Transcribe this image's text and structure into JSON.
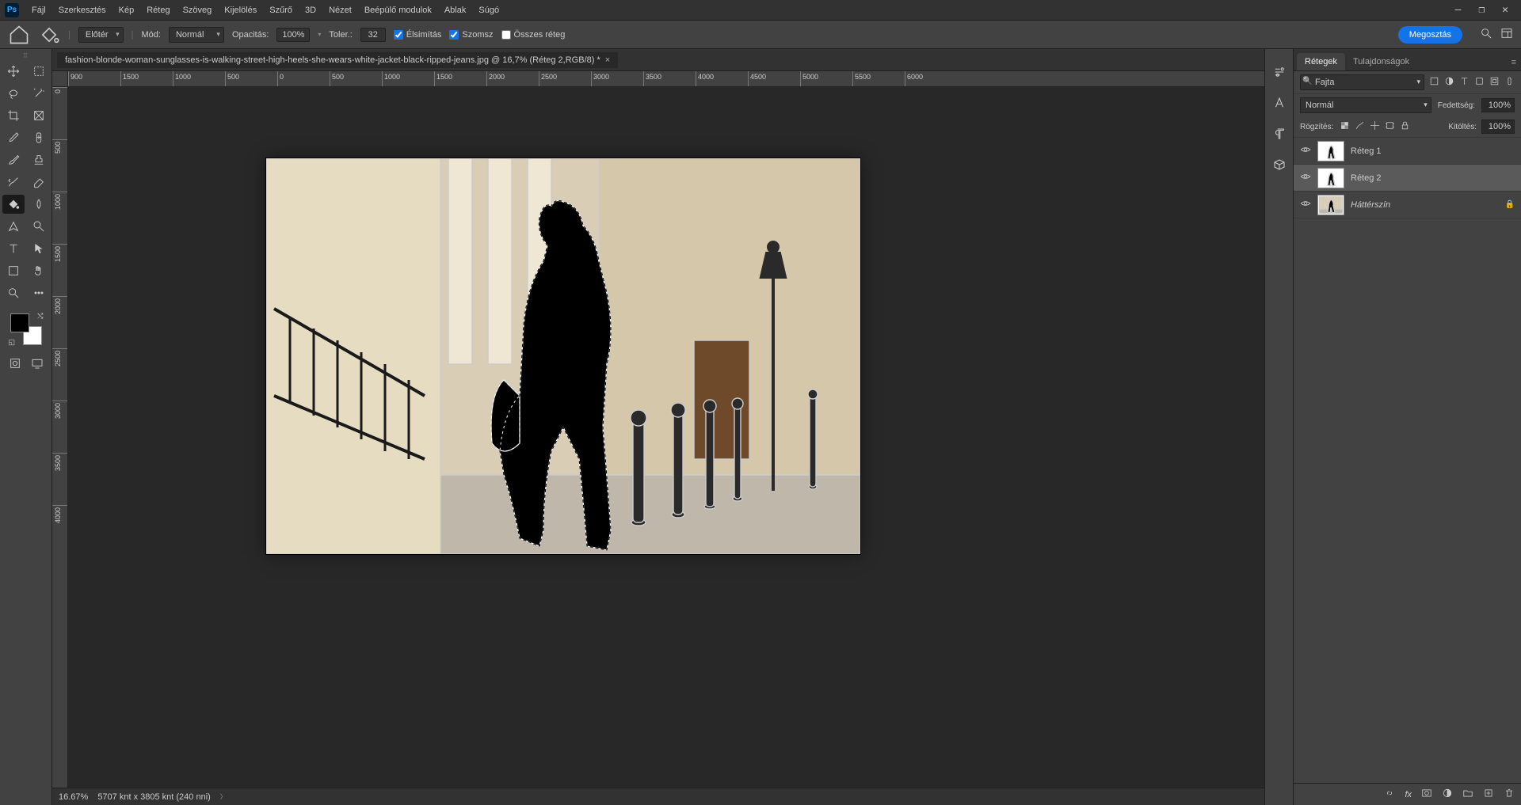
{
  "menu": {
    "items": [
      "Fájl",
      "Szerkesztés",
      "Kép",
      "Réteg",
      "Szöveg",
      "Kijelölés",
      "Szűrő",
      "3D",
      "Nézet",
      "Beépülő modulok",
      "Ablak",
      "Súgó"
    ]
  },
  "window_controls": {
    "min": "—",
    "max": "❐",
    "close": "✕"
  },
  "options": {
    "foreground_mode": "Előtér",
    "mode_label": "Mód:",
    "mode_value": "Normál",
    "opacity_label": "Opacitás:",
    "opacity_value": "100%",
    "tolerance_label": "Toler.:",
    "tolerance_value": "32",
    "antialias": "Élsimítás",
    "contiguous": "Szomsz",
    "all_layers": "Összes réteg",
    "share": "Megosztás"
  },
  "document": {
    "tab_title": "fashion-blonde-woman-sunglasses-is-walking-street-high-heels-she-wears-white-jacket-black-ripped-jeans.jpg @ 16,7% (Réteg 2,RGB/8) *",
    "zoom": "16.67%",
    "dims": "5707 knt x 3805 knt (240 nni)"
  },
  "ruler_h": [
    "-500",
    "-1000",
    "-1500",
    "0",
    "500",
    "1000",
    "1500",
    "2000",
    "2500",
    "3000",
    "3500",
    "4000",
    "4500",
    "5000",
    "5500",
    "6000"
  ],
  "ruler_h_offset_labels": [
    "-500",
    "-1000",
    "-1500",
    "0",
    "500",
    "1000",
    "1500",
    "2000",
    "2500",
    "3000",
    "3500",
    "4000",
    "4500",
    "5000",
    "5500",
    "6000"
  ],
  "ruler_v": [
    "0",
    "500",
    "1000",
    "1500",
    "2000",
    "2500",
    "3000",
    "3500",
    "4000"
  ],
  "panels": {
    "tabs": {
      "layers": "Rétegek",
      "properties": "Tulajdonságok"
    },
    "search_placeholder": "Fajta",
    "blend_mode": "Normál",
    "opacity_label": "Fedettség:",
    "opacity": "100%",
    "lock_label": "Rögzítés:",
    "fill_label": "Kitöltés:",
    "fill": "100%",
    "layers": [
      {
        "name": "Réteg 1",
        "bg": false,
        "active": false,
        "checker": true
      },
      {
        "name": "Réteg 2",
        "bg": false,
        "active": true,
        "checker": true
      },
      {
        "name": "Háttérszín",
        "bg": true,
        "active": false,
        "checker": false,
        "locked": true
      }
    ]
  }
}
